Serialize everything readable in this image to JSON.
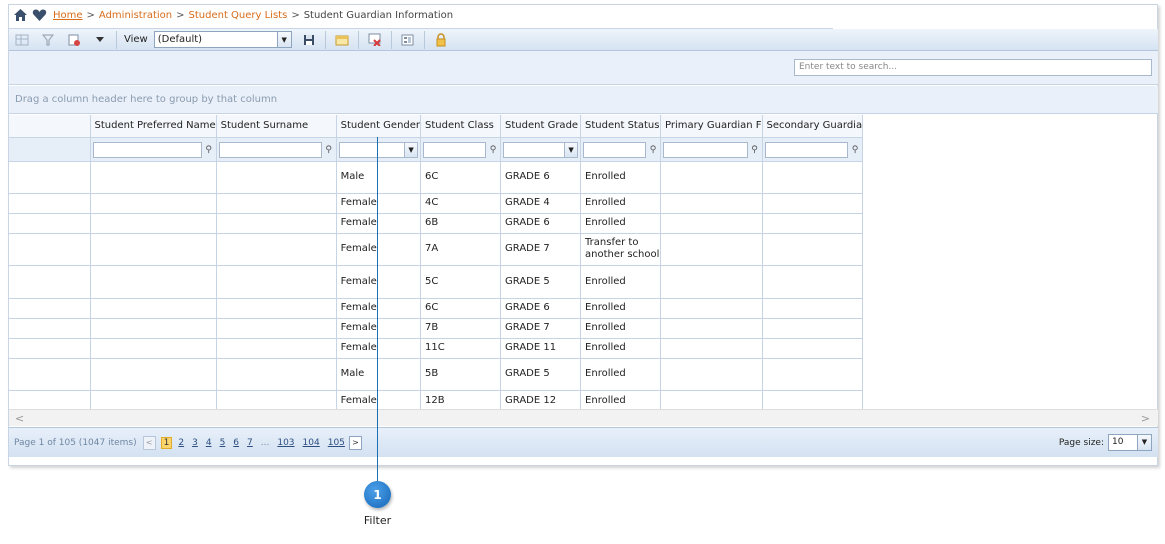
{
  "breadcrumb": {
    "home": "Home",
    "sep": ">",
    "administration": "Administration",
    "student_query_lists": "Student Query Lists",
    "current": "Student Guardian Information"
  },
  "toolbar": {
    "view_label": "View",
    "view_value": "(Default)"
  },
  "search": {
    "placeholder": "Enter text to search..."
  },
  "group_hint": "Drag a column header here to group by that column",
  "columns": [
    "",
    "Student Preferred Name",
    "Student Surname",
    "Student Gender",
    "Student Class",
    "Student Grade",
    "Student Status",
    "Primary Guardian F",
    "Secondary Guardia"
  ],
  "rows": [
    {
      "gender": "Male",
      "class": "6C",
      "grade": "GRADE 6",
      "status": "Enrolled"
    },
    {
      "gender": "Female",
      "class": "4C",
      "grade": "GRADE 4",
      "status": "Enrolled"
    },
    {
      "gender": "Female",
      "class": "6B",
      "grade": "GRADE 6",
      "status": "Enrolled"
    },
    {
      "gender": "Female",
      "class": "7A",
      "grade": "GRADE 7",
      "status": "Transfer to another school"
    },
    {
      "gender": "Female",
      "class": "5C",
      "grade": "GRADE 5",
      "status": "Enrolled"
    },
    {
      "gender": "Female",
      "class": "6C",
      "grade": "GRADE 6",
      "status": "Enrolled"
    },
    {
      "gender": "Female",
      "class": "7B",
      "grade": "GRADE 7",
      "status": "Enrolled"
    },
    {
      "gender": "Female",
      "class": "11C",
      "grade": "GRADE 11",
      "status": "Enrolled"
    },
    {
      "gender": "Male",
      "class": "5B",
      "grade": "GRADE 5",
      "status": "Enrolled"
    },
    {
      "gender": "Female",
      "class": "12B",
      "grade": "GRADE 12",
      "status": "Enrolled"
    }
  ],
  "pager": {
    "info": "Page 1 of 105 (1047 items)",
    "prev": "<",
    "next": ">",
    "pages": [
      "1",
      "2",
      "3",
      "4",
      "5",
      "6",
      "7",
      "...",
      "103",
      "104",
      "105"
    ],
    "current": "1",
    "page_size_label": "Page size:",
    "page_size": "10"
  },
  "callout": {
    "number": "1",
    "label": "Filter"
  },
  "colors": {
    "accent_orange": "#d86c1b",
    "callout_blue": "#1b6fb3"
  }
}
